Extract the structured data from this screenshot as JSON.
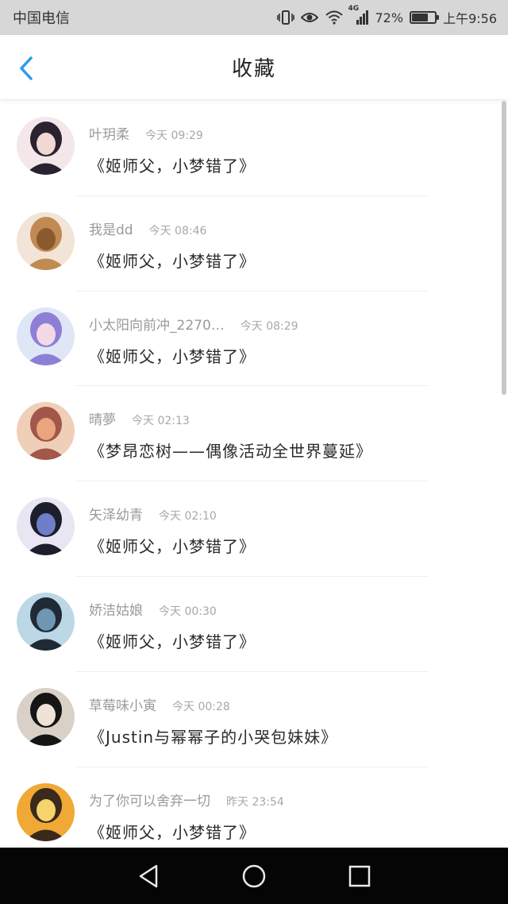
{
  "status_bar": {
    "carrier": "中国电信",
    "network": "4G",
    "battery": "72%",
    "battery_level": 0.72,
    "time": "上午9:56"
  },
  "header": {
    "title": "收藏"
  },
  "colors": {
    "accent": "#2b9be8",
    "meta_text": "#9a9a9a",
    "nav_bg": "#050505"
  },
  "items": [
    {
      "user": "叶玥柔",
      "time": "今天 09:29",
      "book": "《姬师父，小梦错了》"
    },
    {
      "user": "我是dd",
      "time": "今天 08:46",
      "book": "《姬师父，小梦错了》"
    },
    {
      "user": "小太阳向前冲_2270…",
      "time": "今天 08:29",
      "book": "《姬师父，小梦错了》"
    },
    {
      "user": "晴夢",
      "time": "今天 02:13",
      "book": "《梦昂恋树——偶像活动全世界蔓延》"
    },
    {
      "user": "矢泽幼青",
      "time": "今天 02:10",
      "book": "《姬师父，小梦错了》"
    },
    {
      "user": "娇洁姑娘",
      "time": "今天 00:30",
      "book": "《姬师父，小梦错了》"
    },
    {
      "user": "草莓味小寅",
      "time": "今天 00:28",
      "book": "《Justin与幂幂子的小哭包妹妹》"
    },
    {
      "user": "为了你可以舍弃一切",
      "time": "昨天 23:54",
      "book": "《姬师父，小梦错了》"
    }
  ]
}
